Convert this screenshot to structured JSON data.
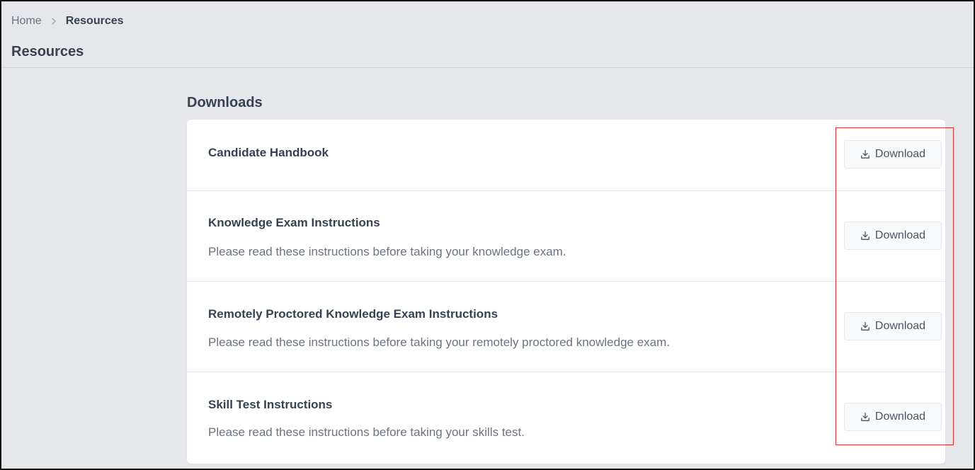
{
  "breadcrumb": {
    "home": "Home",
    "current": "Resources"
  },
  "page_title": "Resources",
  "downloads": {
    "section_title": "Downloads",
    "button_label": "Download",
    "items": [
      {
        "title": "Candidate Handbook",
        "description": ""
      },
      {
        "title": "Knowledge Exam Instructions",
        "description": "Please read these instructions before taking your knowledge exam."
      },
      {
        "title": "Remotely Proctored Knowledge Exam Instructions",
        "description": "Please read these instructions before taking your remotely proctored knowledge exam."
      },
      {
        "title": "Skill Test Instructions",
        "description": "Please read these instructions before taking your skills test."
      }
    ]
  },
  "icons": {
    "breadcrumb_separator": "chevron-right-icon",
    "download": "download-icon"
  },
  "colors": {
    "page_background": "#e5e7eb",
    "card_background": "#ffffff",
    "text_primary": "#374151",
    "text_secondary": "#6b7280",
    "highlight": "#e03131"
  }
}
